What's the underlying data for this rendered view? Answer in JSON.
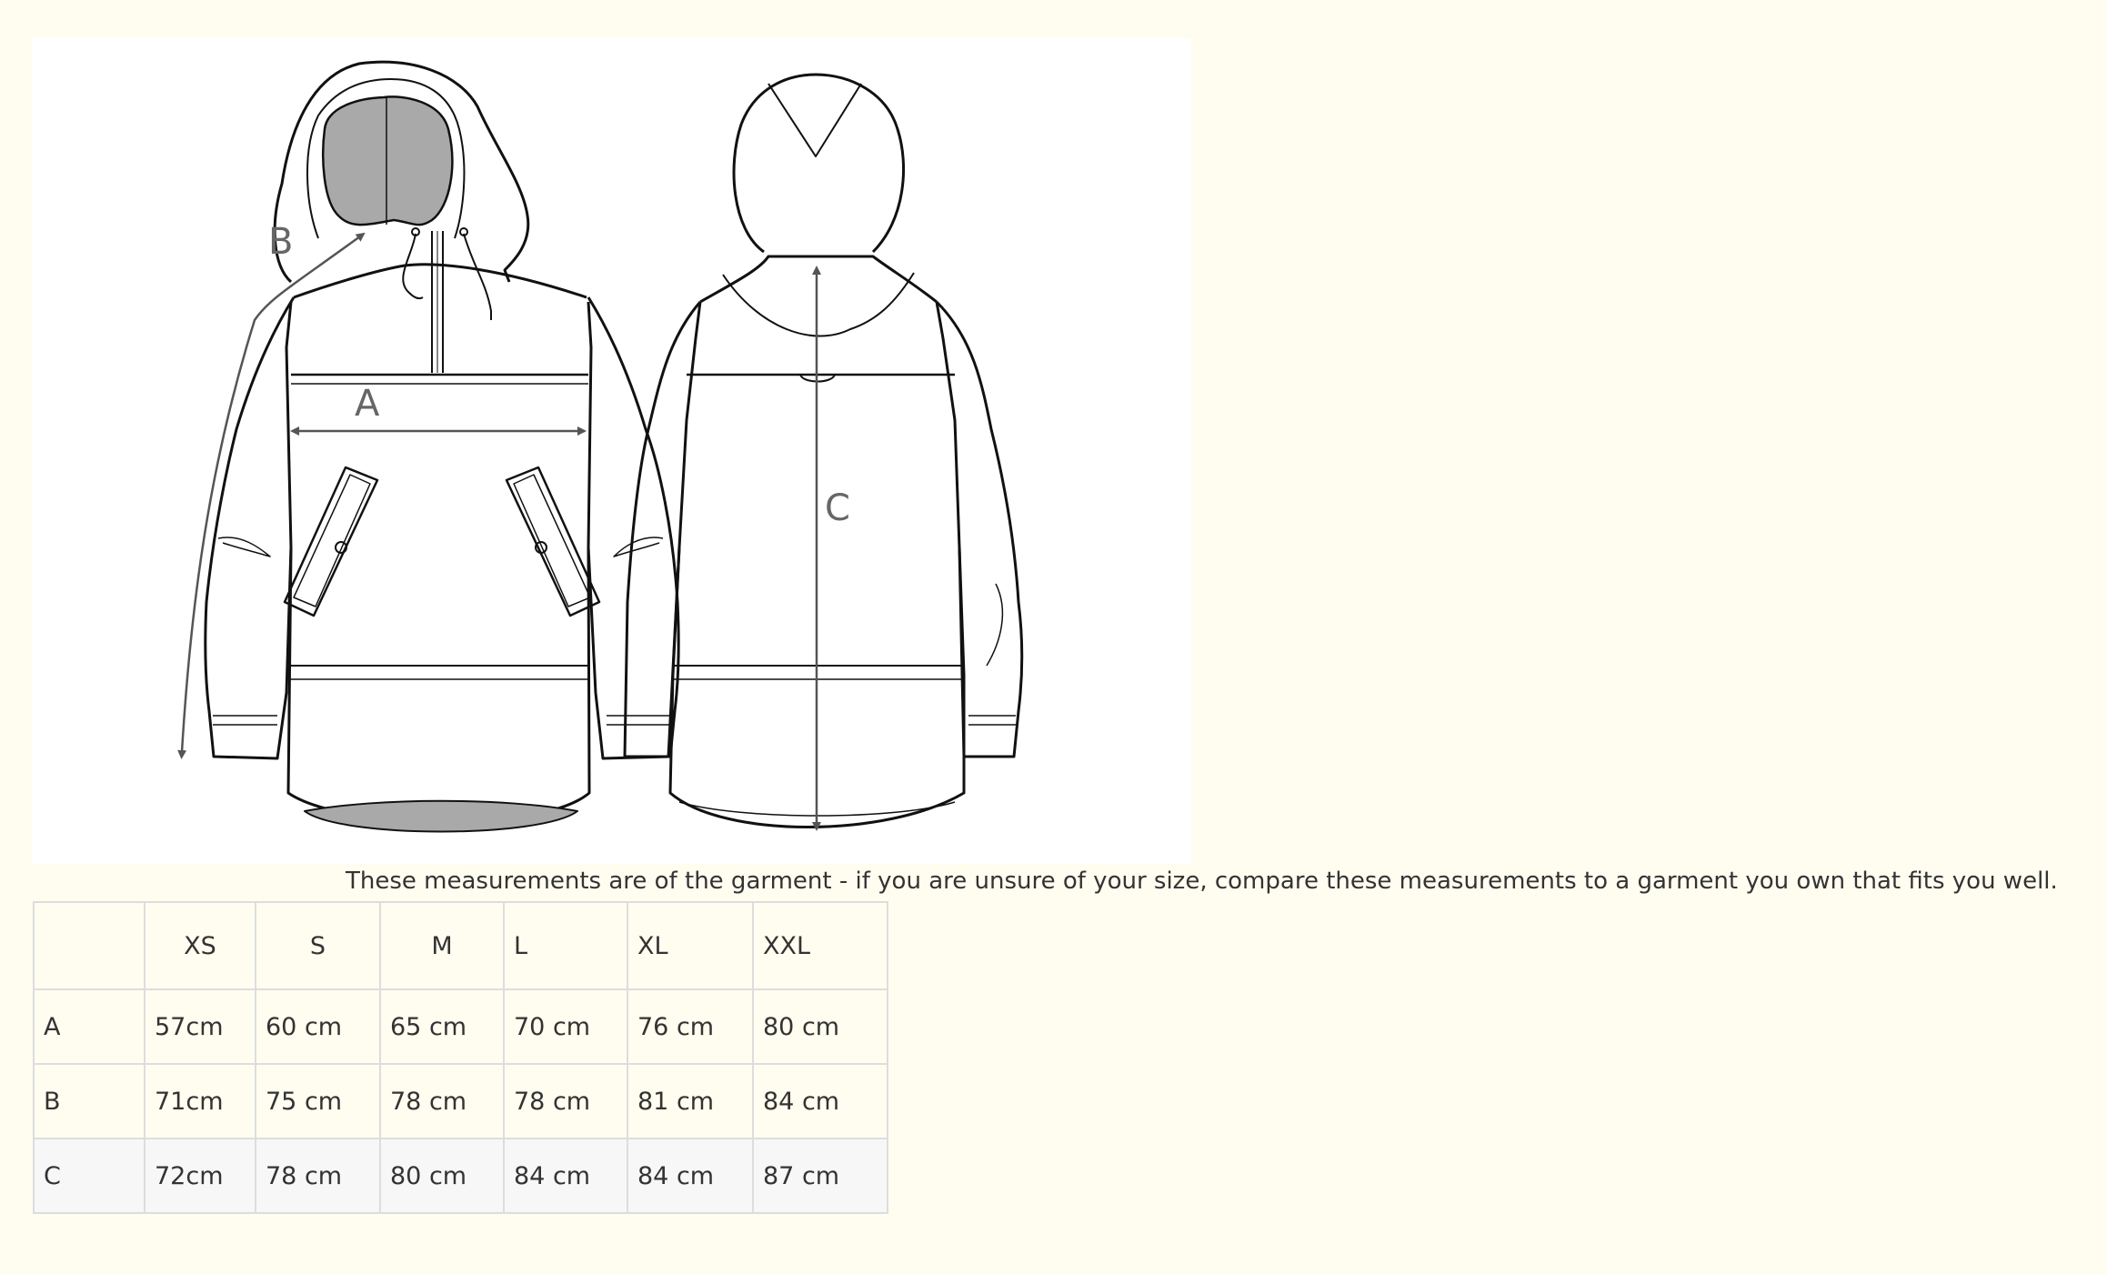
{
  "diagram": {
    "labels": {
      "a": "A",
      "b": "B",
      "c": "C"
    }
  },
  "note": "These measurements are of the garment - if you are unsure of your size, compare these measurements to a garment you own that fits you well.",
  "size_table": {
    "corner": "",
    "sizes": [
      "XS",
      "S",
      "M",
      "L",
      "XL",
      "XXL"
    ],
    "rows": [
      {
        "label": "A",
        "values": [
          "57cm",
          "60 cm",
          "65 cm",
          "70 cm",
          "76 cm",
          "80 cm"
        ]
      },
      {
        "label": "B",
        "values": [
          "71cm",
          "75 cm",
          "78 cm",
          "78 cm",
          "81 cm",
          "84 cm"
        ]
      },
      {
        "label": "C",
        "values": [
          "72cm",
          "78 cm",
          "80 cm",
          "84 cm",
          "84 cm",
          "87 cm"
        ]
      }
    ]
  }
}
